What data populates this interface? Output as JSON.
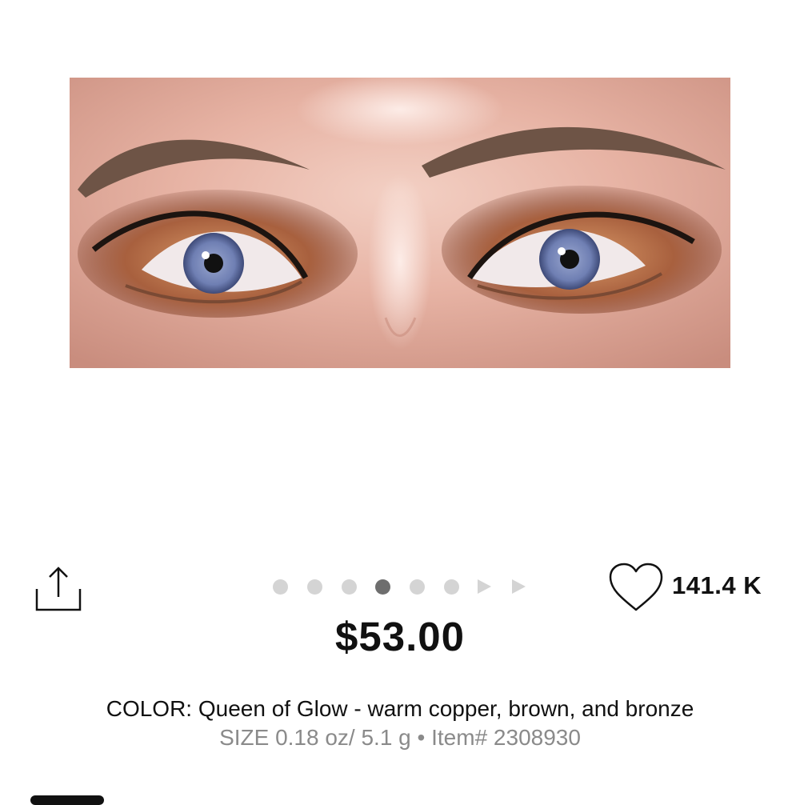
{
  "product_image": {
    "alt": "Close-up of eyes wearing warm copper, brown, and bronze eyeshadow"
  },
  "actions": {
    "share_icon": "share-icon",
    "like_icon": "heart-icon",
    "like_count": "141.4 K"
  },
  "carousel": {
    "total_dots": 6,
    "active_index": 3,
    "video_arrows": 2
  },
  "price": "$53.00",
  "color_line": "COLOR: Queen of Glow - warm copper, brown, and bronze",
  "size_line": "SIZE 0.18 oz/ 5.1 g • Item# 2308930",
  "colors": {
    "dot_inactive": "#d4d4d4",
    "dot_active": "#6e6e6e",
    "secondary_text": "#8a8a8a"
  }
}
